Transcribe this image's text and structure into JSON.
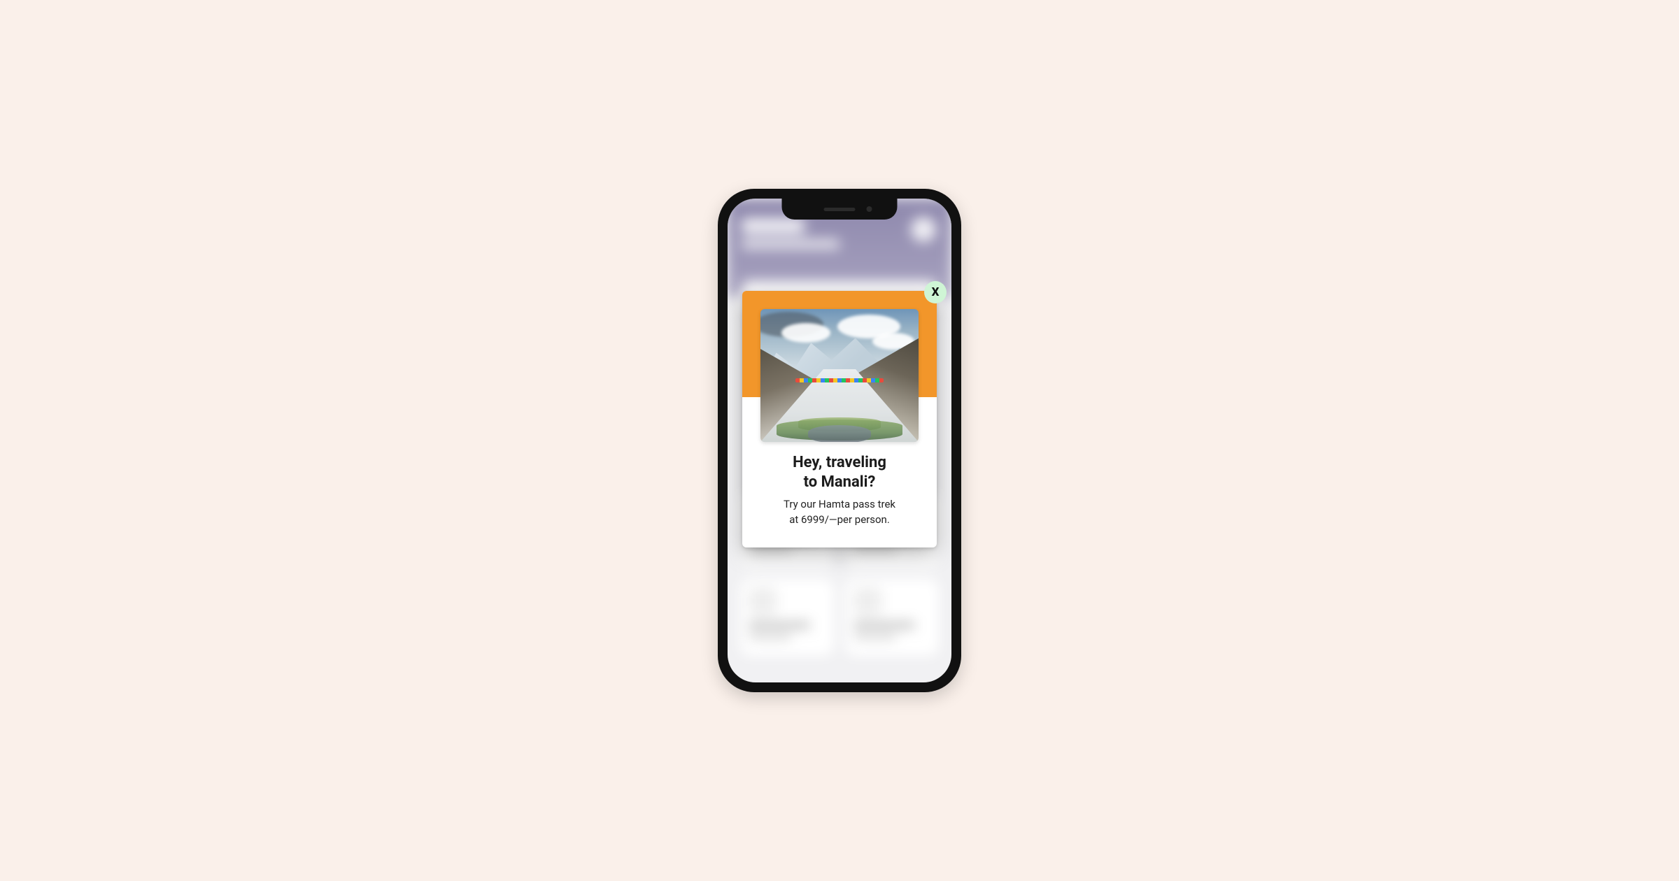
{
  "popup": {
    "title_line1": "Hey, traveling",
    "title_line2": "to Manali?",
    "desc_line1": "Try our Hamta pass trek",
    "desc_line2": "at 6999/—per person.",
    "close_label": "X"
  },
  "colors": {
    "accent": "#F2962A",
    "close_bg": "#CFF5D5",
    "page_bg": "#FAF0EA"
  }
}
